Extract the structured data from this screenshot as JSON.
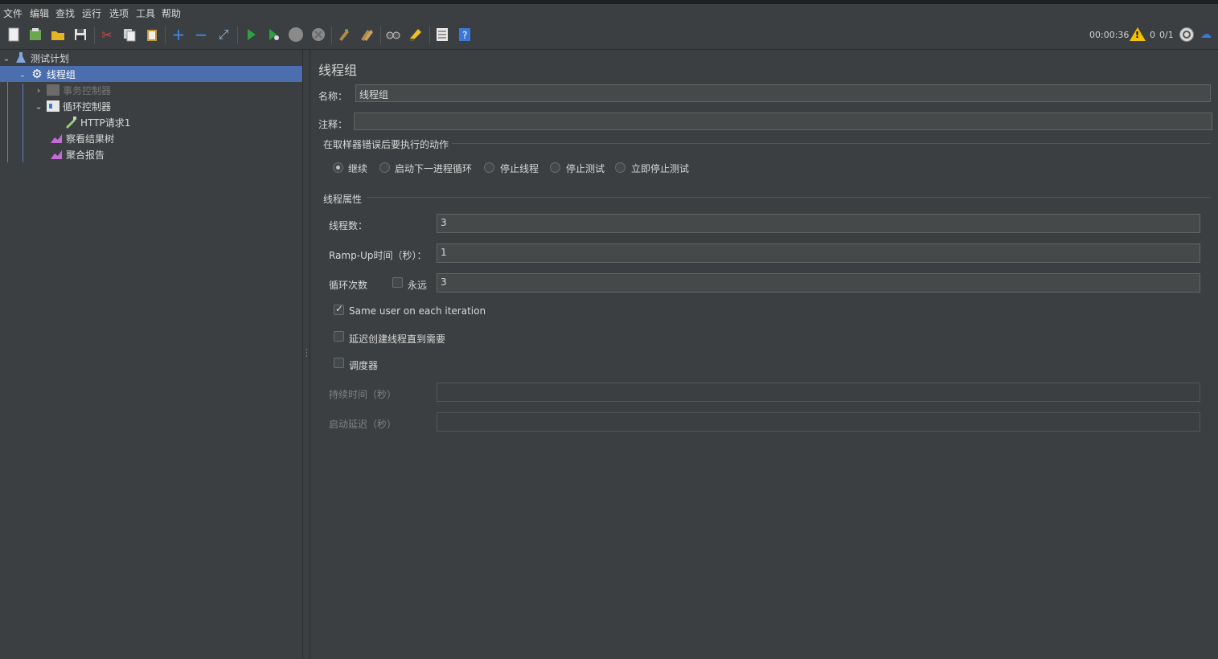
{
  "menu": [
    "文件",
    "编辑",
    "查找",
    "运行",
    "选项",
    "工具",
    "帮助"
  ],
  "toolbar": {
    "icons": [
      "new-icon",
      "templates-icon",
      "open-icon",
      "save-icon",
      "cut-icon",
      "copy-icon",
      "paste-icon",
      "expand-icon",
      "collapse-icon",
      "toggle-icon",
      "start-icon",
      "start-no-pause-icon",
      "stop-icon",
      "shutdown-icon",
      "clear-icon",
      "clear-all-icon",
      "search-icon",
      "reset-search-icon",
      "function-helper-icon",
      "help-icon"
    ]
  },
  "status": {
    "elapsed": "00:00:36",
    "warnings": "0",
    "threads": "0/1"
  },
  "tree": {
    "test_plan": "测试计划",
    "thread_group": "线程组",
    "transaction_controller": "事务控制器",
    "loop_controller": "循环控制器",
    "http_request": "HTTP请求1",
    "view_results_tree": "察看结果树",
    "aggregate_report": "聚合报告"
  },
  "panel": {
    "title": "线程组",
    "name_label": "名称：",
    "name_value": "线程组",
    "comment_label": "注释：",
    "comment_value": "",
    "error_action_section": "在取样器错误后要执行的动作",
    "actions": [
      "继续",
      "启动下一进程循环",
      "停止线程",
      "停止测试",
      "立即停止测试"
    ],
    "selected_action": "继续",
    "thread_props_section": "线程属性",
    "threads_label": "线程数：",
    "threads_value": "3",
    "rampup_label": "Ramp-Up时间（秒）：",
    "rampup_value": "1",
    "loop_label": "循环次数",
    "forever_label": "永远",
    "loop_value": "3",
    "same_user_label": "Same user on each iteration",
    "delay_create_label": "延迟创建线程直到需要",
    "scheduler_label": "调度器",
    "duration_label": "持续时间（秒）",
    "duration_value": "",
    "startup_delay_label": "启动延迟（秒）",
    "startup_delay_value": ""
  },
  "colors": {
    "background": "#3c3f41",
    "selection": "#4b6eaf",
    "field": "#45494a",
    "warning": "#f2c200"
  }
}
